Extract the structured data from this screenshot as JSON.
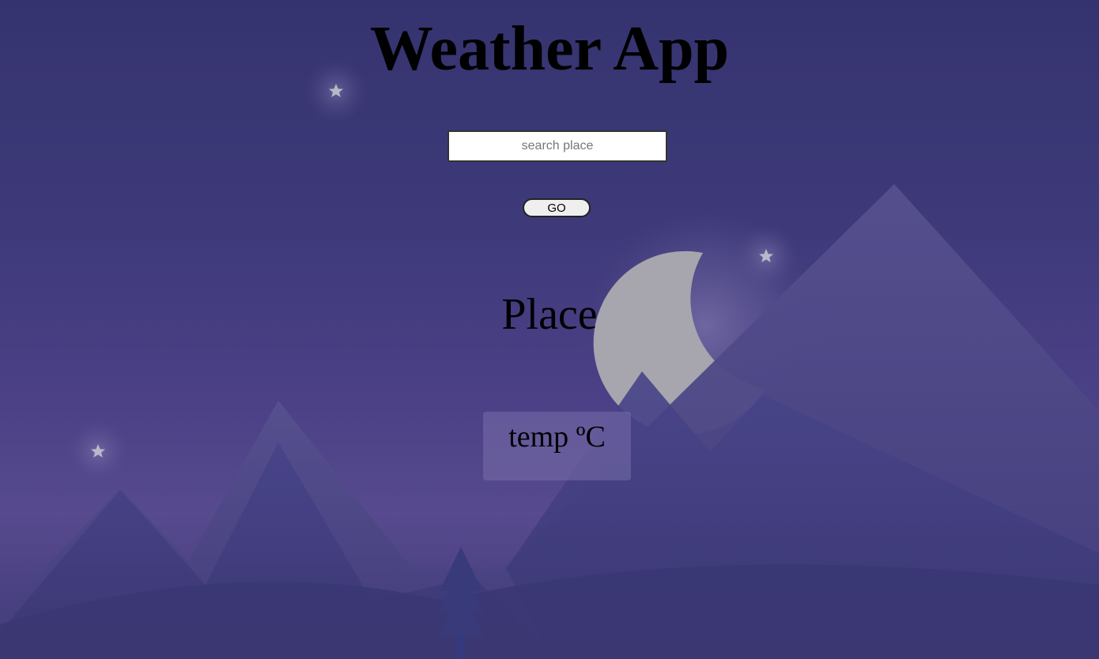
{
  "header": {
    "title": "Weather App"
  },
  "search": {
    "placeholder": "search place",
    "value": ""
  },
  "actions": {
    "go_label": "GO"
  },
  "weather": {
    "place": "Place",
    "temperature": "temp ºC"
  },
  "colors": {
    "sky_top": "#35336f",
    "sky_mid": "#574a8e",
    "mountain": "#4a4a8a",
    "moon": "#a8a8a8",
    "star": "#b8b8c8",
    "card": "#6e6a9e"
  },
  "icons": {
    "moon": "crescent-moon-icon",
    "star": "star-icon",
    "tree": "pine-tree-icon"
  }
}
